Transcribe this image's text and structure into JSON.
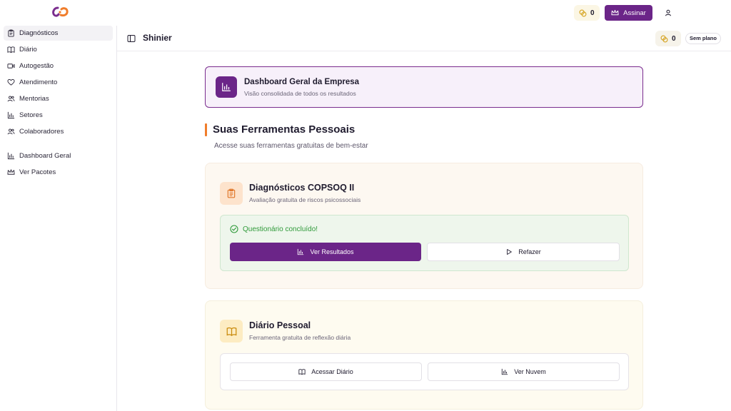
{
  "topbar": {
    "logo": "brand-logo",
    "coins": "0",
    "subscribe_label": "Assinar",
    "user": "user-icon"
  },
  "sidebar": {
    "items": [
      {
        "label": "Diagnósticos",
        "icon": "clipboard-icon",
        "active": true
      },
      {
        "label": "Diário",
        "icon": "book-icon"
      },
      {
        "label": "Autogestão",
        "icon": "video-icon"
      },
      {
        "label": "Atendimento",
        "icon": "heart-icon"
      },
      {
        "label": "Mentorias",
        "icon": "users-icon"
      },
      {
        "label": "Setores",
        "icon": "bar-chart-icon"
      },
      {
        "label": "Colaboradores",
        "icon": "users-icon"
      }
    ],
    "secondary_items": [
      {
        "label": "Dashboard Geral",
        "icon": "bar-chart-icon"
      },
      {
        "label": "Ver Pacotes",
        "icon": "crown-icon"
      }
    ]
  },
  "header": {
    "title": "Shinier",
    "coins": "0",
    "plan": "Sem plano"
  },
  "dashboard_card": {
    "title": "Dashboard Geral da Empresa",
    "subtitle": "Visão consolidada de todos os resultados"
  },
  "section": {
    "title": "Suas Ferramentas Pessoais",
    "subtitle": "Acesse suas ferramentas gratuitas de bem-estar"
  },
  "copsoq": {
    "title": "Diagnósticos COPSOQ II",
    "subtitle": "Avaliação gratuita de riscos psicossociais",
    "status": "Questionário concluído!",
    "primary_label": "Ver Resultados",
    "secondary_label": "Refazer"
  },
  "diario": {
    "title": "Diário Pessoal",
    "subtitle": "Ferramenta gratuita de reflexão diária",
    "access_label": "Acessar Diário",
    "cloud_label": "Ver Nuvem"
  },
  "colors": {
    "brand_purple": "#6b2588",
    "accent_orange": "#f07d2b",
    "success_green": "#2f9a3a"
  }
}
